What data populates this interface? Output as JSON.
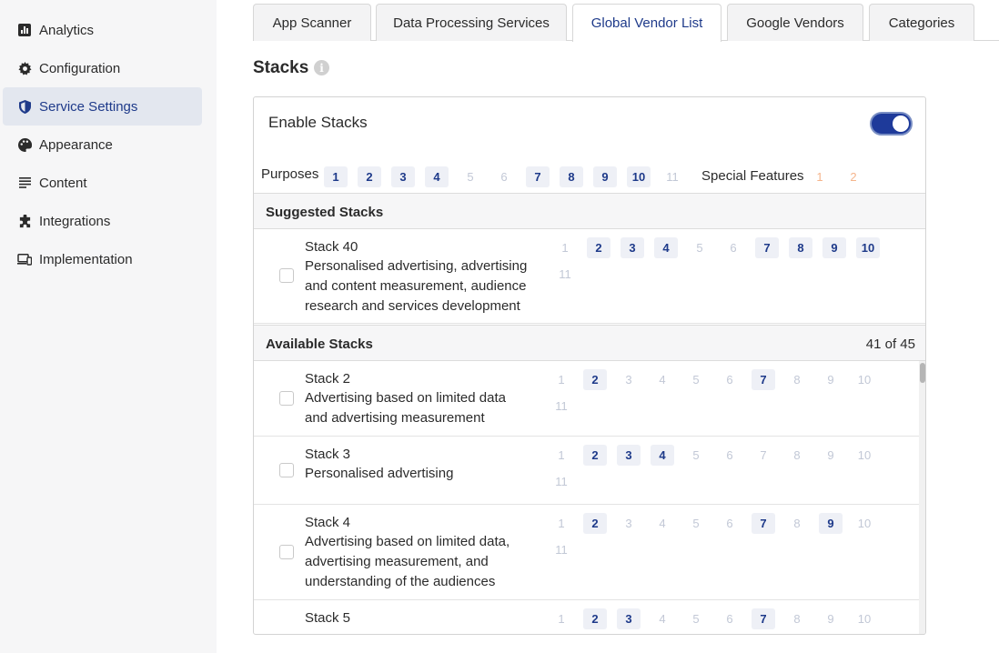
{
  "sidebar": {
    "items": [
      {
        "label": "Analytics",
        "icon": "bar-chart-icon"
      },
      {
        "label": "Configuration",
        "icon": "gear-icon"
      },
      {
        "label": "Service Settings",
        "icon": "shield-icon",
        "active": true
      },
      {
        "label": "Appearance",
        "icon": "palette-icon"
      },
      {
        "label": "Content",
        "icon": "lines-icon"
      },
      {
        "label": "Integrations",
        "icon": "puzzle-icon"
      },
      {
        "label": "Implementation",
        "icon": "devices-icon"
      }
    ]
  },
  "tabs": [
    {
      "label": "App Scanner"
    },
    {
      "label": "Data Processing Services"
    },
    {
      "label": "Global Vendor List",
      "active": true
    },
    {
      "label": "Google Vendors"
    },
    {
      "label": "Categories"
    }
  ],
  "stacks": {
    "title": "Stacks",
    "info_icon": "i",
    "enable_label": "Enable Stacks",
    "enabled": true,
    "purposes_label": "Purposes",
    "purposes": [
      {
        "n": "1",
        "on": true
      },
      {
        "n": "2",
        "on": true
      },
      {
        "n": "3",
        "on": true
      },
      {
        "n": "4",
        "on": true
      },
      {
        "n": "5",
        "on": false
      },
      {
        "n": "6",
        "on": false
      },
      {
        "n": "7",
        "on": true
      },
      {
        "n": "8",
        "on": true
      },
      {
        "n": "9",
        "on": true
      },
      {
        "n": "10",
        "on": true
      },
      {
        "n": "11",
        "on": false
      }
    ],
    "special_features_label": "Special Features",
    "special_features": [
      "1",
      "2"
    ],
    "suggested_title": "Suggested Stacks",
    "suggested": [
      {
        "name": "Stack 40",
        "desc": "Personalised advertising, advertising and content measurement, audience research and services development",
        "purposes_on": [
          "2",
          "3",
          "4",
          "7",
          "8",
          "9",
          "10"
        ]
      }
    ],
    "available_title": "Available Stacks",
    "available_count": "41 of 45",
    "available": [
      {
        "name": "Stack 2",
        "desc": "Advertising based on limited data and advertising measurement",
        "purposes_on": [
          "2",
          "7"
        ]
      },
      {
        "name": "Stack 3",
        "desc": "Personalised advertising",
        "purposes_on": [
          "2",
          "3",
          "4"
        ]
      },
      {
        "name": "Stack 4",
        "desc": "Advertising based on limited data, advertising measurement, and understanding of the audiences",
        "purposes_on": [
          "2",
          "7",
          "9"
        ]
      },
      {
        "name": "Stack 5",
        "desc": "",
        "purposes_on": [
          "2",
          "3",
          "7"
        ]
      }
    ]
  },
  "colors": {
    "accent": "#1e3a8a",
    "toggle": "#1e3a9a",
    "special_feature": "#f5b58c",
    "purpose_off": "#c2c8d6"
  }
}
